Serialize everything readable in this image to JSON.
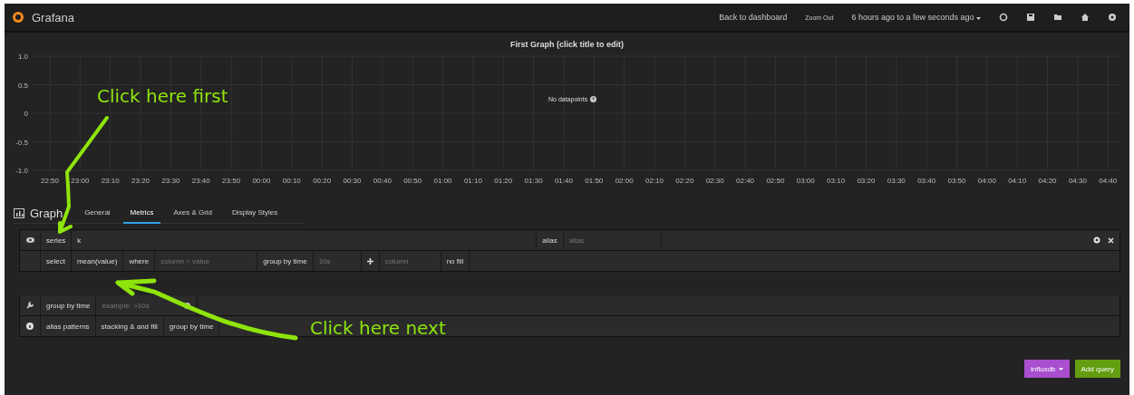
{
  "nav": {
    "brand": "Grafana",
    "links": [
      "Back to dashboard",
      "Zoom Out"
    ],
    "time_range": "6 hours ago to a few seconds ago"
  },
  "panel": {
    "title": "First Graph (click title to edit)",
    "message": "No datapoints",
    "chart_data": {
      "type": "line",
      "grid": true,
      "ylim": [
        -1,
        1
      ],
      "yticks": [
        {
          "value": 1,
          "label": "1.0"
        },
        {
          "value": 0.5,
          "label": "0.5"
        },
        {
          "value": 0,
          "label": "0"
        },
        {
          "value": -0.5,
          "label": "-0.5"
        },
        {
          "value": -1,
          "label": "-1.0"
        }
      ],
      "values": [
        null,
        null,
        null,
        null,
        null,
        null,
        null,
        null,
        null,
        null,
        null,
        null,
        null,
        null,
        null,
        null,
        null,
        null,
        null,
        null,
        null,
        null,
        null,
        null,
        null,
        null,
        null,
        null,
        null,
        null,
        null,
        null,
        null,
        null,
        null,
        null
      ],
      "categories": [
        "22:50",
        "23:00",
        "23:10",
        "23:20",
        "23:30",
        "23:40",
        "23:50",
        "00:00",
        "00:10",
        "00:20",
        "00:30",
        "00:40",
        "00:50",
        "01:00",
        "01:10",
        "01:20",
        "01:30",
        "01:40",
        "01:50",
        "02:00",
        "02:10",
        "02:20",
        "02:30",
        "02:40",
        "02:50",
        "03:00",
        "03:10",
        "03:20",
        "03:30",
        "03:40",
        "03:50",
        "04:00",
        "04:10",
        "04:20",
        "04:30",
        "04:40"
      ]
    }
  },
  "editor": {
    "title": "Graph",
    "tabs": [
      {
        "label": "General",
        "selected": false
      },
      {
        "label": "Metrics",
        "selected": true
      },
      {
        "label": "Axes & Grid",
        "selected": false
      },
      {
        "label": "Display Styles",
        "selected": false
      }
    ]
  },
  "query": {
    "series_label": "series",
    "series_value": "k",
    "alias_label": "alias",
    "alias_placeholder": "alias",
    "select_label": "select",
    "select_value": "mean(value)",
    "where_label": "where",
    "where_placeholder": "column = value",
    "group_label": "group by time",
    "group_placeholder": "10s",
    "column_placeholder": "column",
    "fill": "no fill"
  },
  "options": {
    "group_label": "group by time",
    "group_placeholder": "example: >10s",
    "help_items": [
      "alias patterns",
      "stacking & and fill",
      "group by time"
    ]
  },
  "buttons": {
    "datasource": "influxdb",
    "add": "Add query"
  },
  "annotations": [
    {
      "text": "Click here first"
    },
    {
      "text": "Click here next"
    }
  ]
}
